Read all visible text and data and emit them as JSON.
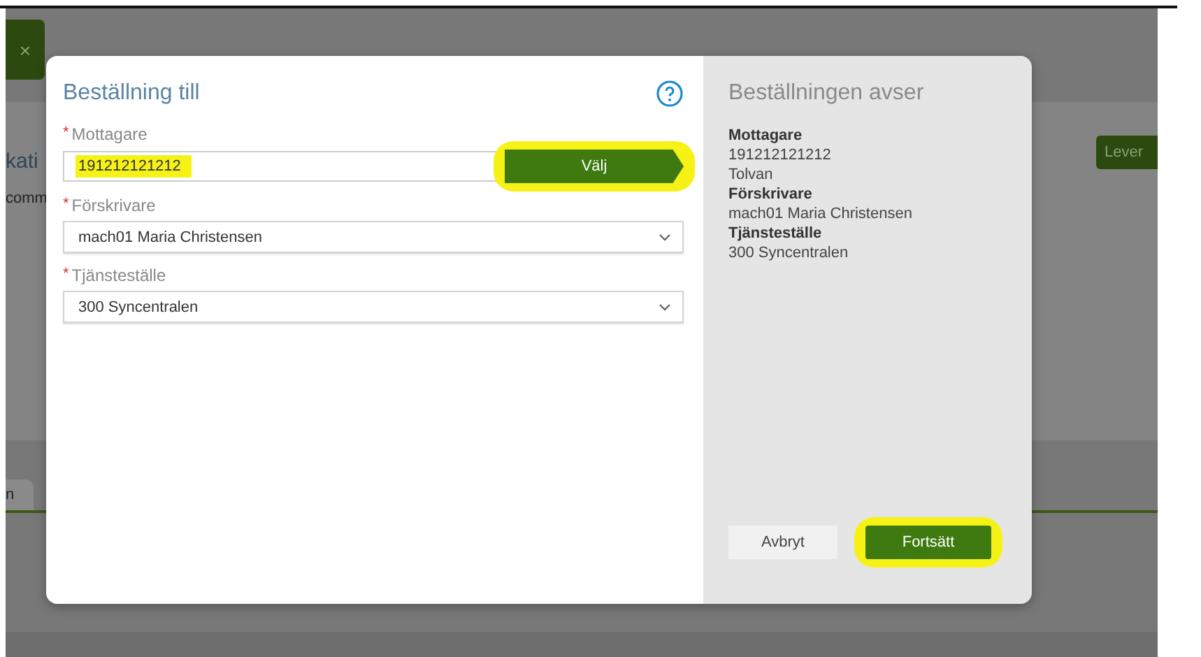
{
  "background": {
    "close_button": "×",
    "heading": "kati",
    "text": "comm",
    "button": "Lever",
    "tab": "n"
  },
  "dialog": {
    "title": "Beställning till",
    "fields": [
      {
        "label": "Mottagare",
        "marker": "*",
        "kind": "text",
        "value": "191212121212",
        "highlighted": true,
        "button": "Välj"
      },
      {
        "label": "Förskrivare",
        "marker": "*",
        "kind": "select",
        "value": "mach01 Maria Christensen",
        "highlighted": false
      },
      {
        "label": "Tjänsteställe",
        "marker": "*",
        "kind": "select",
        "value": "300 Syncentralen",
        "highlighted": false
      }
    ]
  },
  "summary": {
    "title": "Beställningen avser",
    "lines": [
      {
        "text": "Mottagare",
        "kind": "heading"
      },
      {
        "text": "191212121212",
        "kind": "value"
      },
      {
        "text": "Tolvan",
        "kind": "value"
      },
      {
        "text": "Förskrivare",
        "kind": "heading"
      },
      {
        "text": "mach01 Maria Christensen",
        "kind": "value"
      },
      {
        "text": "Tjänsteställe",
        "kind": "heading"
      },
      {
        "text": "300 Syncentralen",
        "kind": "value"
      }
    ]
  },
  "buttons": [
    {
      "label": "Avbryt",
      "kind": "secondary",
      "highlighted": false
    },
    {
      "label": "Fortsätt",
      "kind": "primary",
      "highlighted": true
    }
  ]
}
